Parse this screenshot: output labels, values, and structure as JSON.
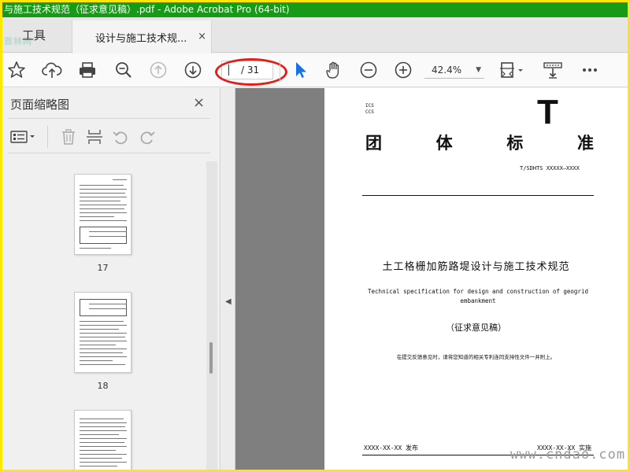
{
  "window": {
    "title": "与施工技术规范（征求意见稿）.pdf - Adobe Acrobat Pro (64-bit)",
    "watermark_logo": "首林网"
  },
  "tabs": {
    "tools_label": "工具",
    "document_label": "设计与施工技术规...",
    "close_symbol": "×"
  },
  "toolbar": {
    "page_total": "/ 31",
    "zoom_value": "42.4%"
  },
  "left_panel": {
    "title": "页面缩略图",
    "close_symbol": "×",
    "thumbnails": [
      {
        "label": "17"
      },
      {
        "label": "18"
      }
    ]
  },
  "page": {
    "ics_line1": "ICS",
    "ics_line2": "CCS",
    "big_letter": "T",
    "std_title_chars": [
      "团",
      "体",
      "标",
      "准"
    ],
    "std_code": "T/SDHTS XXXXX—XXXX",
    "cn_title": "土工格栅加筋路堤设计与施工技术规范",
    "en_title": "Technical specification for design and construction of geogrid embankment",
    "draft_label": "（征求意见稿）",
    "note": "在提交反馈意见时，请将您知道的相关专利连同支持性文件一并附上。",
    "publish": "XXXX-XX-XX 发布",
    "implement": "XXXX-XX-XX 实施"
  },
  "site_watermark": "www.cndao.com",
  "colors": {
    "titlebar": "#179b17",
    "border_yellow": "#ffe700",
    "annotation_red": "#e0201b",
    "cursor_blue": "#1473e6"
  }
}
